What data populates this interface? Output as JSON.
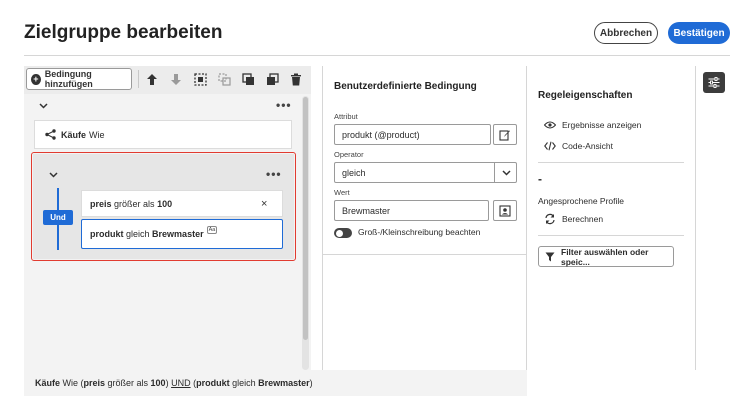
{
  "header": {
    "title": "Zielgruppe bearbeiten",
    "cancel_label": "Abbrechen",
    "confirm_label": "Bestätigen"
  },
  "toolbar": {
    "add_condition_label": "Bedingung hinzufügen",
    "icons": [
      "arrow-up-icon",
      "arrow-down-icon",
      "group-icon",
      "ungroup-icon",
      "copy-icon",
      "duplicate-icon",
      "trash-icon"
    ]
  },
  "canvas": {
    "kaufe_card": {
      "name": "Käufe",
      "suffix": "Wie"
    },
    "group": {
      "operator": "Und",
      "conditions": [
        {
          "attribute": "preis",
          "op": "größer als",
          "value": "100"
        },
        {
          "attribute": "produkt",
          "op": "gleich",
          "value": "Brewmaster",
          "badge": "Aa"
        }
      ]
    }
  },
  "status_bar": {
    "p1": "Käufe",
    "p2": " Wie (",
    "p3": "preis",
    "p4": " größer als ",
    "p5": "100",
    "p6": ") ",
    "p7": "UND",
    "p8": " (",
    "p9": "produkt",
    "p10": " gleich ",
    "p11": "Brewmaster",
    "p12": ")"
  },
  "custom_condition": {
    "title": "Benutzerdefinierte Bedingung",
    "attribute_label": "Attribut",
    "attribute_value": "produkt (@product)",
    "operator_label": "Operator",
    "operator_value": "gleich",
    "value_label": "Wert",
    "value_value": "Brewmaster",
    "case_sensitive_label": "Groß-/Kleinschreibung beachten",
    "case_sensitive_on": true
  },
  "rule_properties": {
    "title": "Regeleigenschaften",
    "show_results": "Ergebnisse anzeigen",
    "code_view": "Code-Ansicht",
    "profiles_value": "-",
    "profiles_label": "Angesprochene Profile",
    "calculate": "Berechnen",
    "filter_button": "Filter auswählen oder speic..."
  },
  "colors": {
    "primary": "#1f6bd6",
    "selection_border": "#e13b30",
    "panel_bg": "#f3f3f3",
    "dark_button": "#3c3c3c"
  }
}
